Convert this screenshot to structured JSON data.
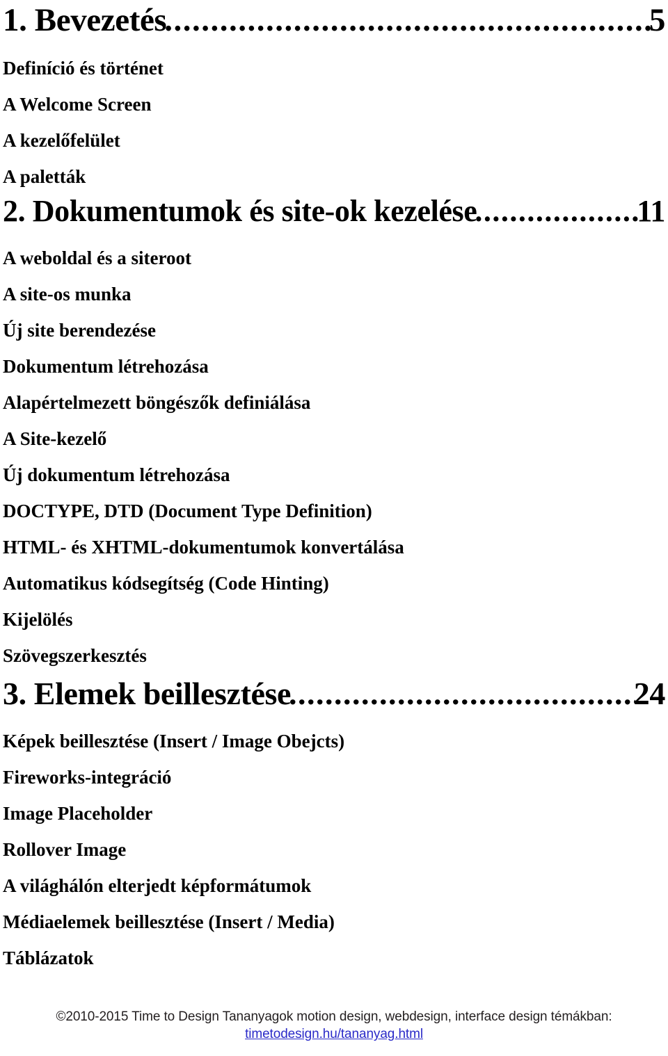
{
  "document": {
    "language": "hu",
    "page_kind": "table-of-contents"
  },
  "toc": {
    "leader_dots": "..............................................................................................................",
    "chapters": [
      {
        "number_title": "1. Bevezetés",
        "page": "5",
        "entries": [
          "Definíció és történet",
          "A Welcome Screen",
          "A kezelőfelület",
          "A paletták"
        ]
      },
      {
        "number_title": "2. Dokumentumok és site-ok kezelése",
        "page": "11",
        "entries": [
          "A weboldal és a siteroot",
          "A site-os munka",
          "Új site berendezése",
          "Dokumentum létrehozása",
          "Alapértelmezett böngészők definiálása",
          "A Site-kezelő",
          "Új dokumentum létrehozása",
          "DOCTYPE, DTD (Document Type Definition)",
          "HTML- és XHTML-dokumentumok konvertálása",
          "Automatikus kódsegítség (Code Hinting)",
          "Kijelölés",
          "Szövegszerkesztés"
        ]
      },
      {
        "number_title": "3. Elemek beillesztése",
        "page": "24",
        "entries": [
          "Képek beillesztése (Insert / Image Obejcts)",
          "Fireworks-integráció",
          "Image Placeholder",
          "Rollover Image",
          "A világhálón elterjedt képformátumok",
          "Médiaelemek beillesztése (Insert / Media)",
          "Táblázatok"
        ]
      }
    ]
  },
  "footer": {
    "copyright": "©2010-2015 Time to Design Tananyagok motion design, webdesign, interface design témákban:",
    "link_text": "timetodesign.hu/tananyag.html",
    "link_color": "#2a2ac8"
  }
}
